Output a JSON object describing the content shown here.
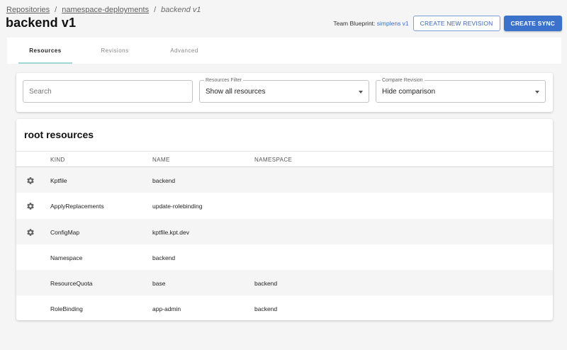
{
  "breadcrumb": {
    "items": [
      "Repositories",
      "namespace-deployments"
    ],
    "separator": "/",
    "current": "backend v1"
  },
  "page": {
    "title": "backend v1"
  },
  "header": {
    "blueprint_prefix": "Team Blueprint:",
    "blueprint_link": "simplens v1",
    "create_revision_label": "CREATE NEW REVISION",
    "create_sync_label": "CREATE SYNC"
  },
  "tabs": [
    {
      "label": "Resources",
      "active": true
    },
    {
      "label": "Revisions",
      "active": false
    },
    {
      "label": "Advanced",
      "active": false
    }
  ],
  "filters": {
    "search_placeholder": "Search",
    "resources_filter_label": "Resources Filter",
    "resources_filter_value": "Show all resources",
    "compare_label": "Compare Revision",
    "compare_value": "Hide comparison"
  },
  "resources": {
    "title": "root resources",
    "columns": [
      "KIND",
      "NAME",
      "NAMESPACE"
    ],
    "rows": [
      {
        "has_icon": true,
        "icon": "gear-icon",
        "kind": "Kptfile",
        "name": "backend",
        "namespace": ""
      },
      {
        "has_icon": true,
        "icon": "gear-icon",
        "kind": "ApplyReplacements",
        "name": "update-rolebinding",
        "namespace": ""
      },
      {
        "has_icon": true,
        "icon": "gear-icon",
        "kind": "ConfigMap",
        "name": "kptfile.kpt.dev",
        "namespace": ""
      },
      {
        "has_icon": false,
        "kind": "Namespace",
        "name": "backend",
        "namespace": ""
      },
      {
        "has_icon": false,
        "kind": "ResourceQuota",
        "name": "base",
        "namespace": "backend"
      },
      {
        "has_icon": false,
        "kind": "RoleBinding",
        "name": "app-admin",
        "namespace": "backend"
      }
    ]
  },
  "colors": {
    "primary": "#3a72cc",
    "link": "#3c6fc4",
    "tab_indicator": "#9fd7d2"
  }
}
